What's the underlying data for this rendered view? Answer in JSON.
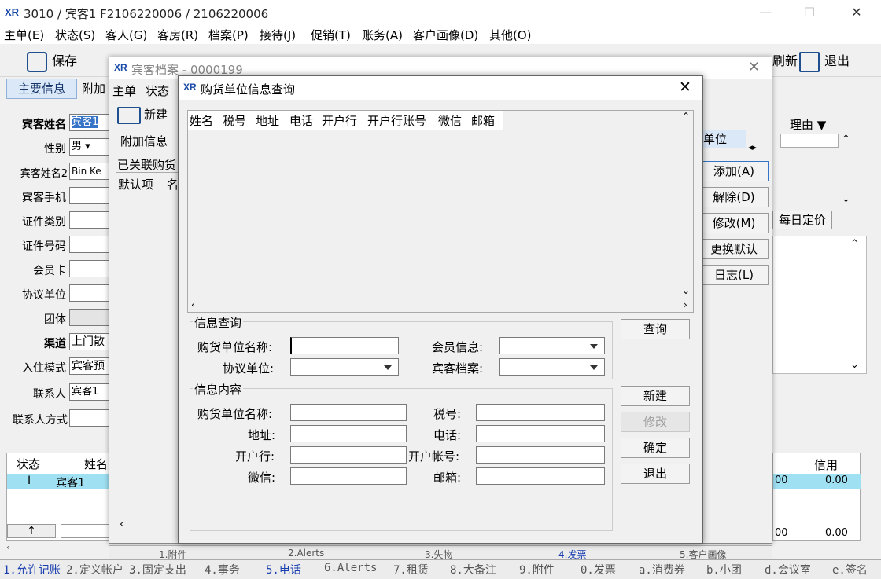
{
  "window": {
    "logo": "XR",
    "title": "3010 / 宾客1 F2106220006 / 2106220006"
  },
  "menu": [
    "主单(E)",
    "状态(S)",
    "客人(G)",
    "客房(R)",
    "档案(P)",
    "接待(J)",
    "促销(T)",
    "账务(A)",
    "客户画像(D)",
    "其他(O)"
  ],
  "toolbar": {
    "save": "保存",
    "refresh": "刷新",
    "exit": "退出"
  },
  "main": {
    "tab_main": "主要信息",
    "tab_extra": "附加",
    "fields": [
      {
        "label": "宾客姓名",
        "value": "宾客1"
      },
      {
        "label": "性别",
        "value": "男"
      },
      {
        "label": "宾客姓名2",
        "value": "Bin Ke"
      },
      {
        "label": "宾客手机",
        "value": ""
      },
      {
        "label": "证件类别",
        "value": ""
      },
      {
        "label": "证件号码",
        "value": ""
      },
      {
        "label": "会员卡",
        "value": ""
      },
      {
        "label": "协议单位",
        "value": ""
      },
      {
        "label": "团体",
        "value": ""
      },
      {
        "label": "渠道",
        "value": "上门散"
      },
      {
        "label": "入住模式",
        "value": "宾客预"
      },
      {
        "label": "联系人",
        "value": "宾客1"
      },
      {
        "label": "联系人方式",
        "value": ""
      }
    ],
    "grid_headers": [
      "状态",
      "姓名"
    ],
    "grid_row": {
      "status": "I",
      "name": "宾客1"
    },
    "right_headers": {
      "reason": "理由",
      "credit": "信用"
    },
    "right_values": {
      "v1": "00",
      "v2": "0.00",
      "v3": "00",
      "v4": "0.00"
    },
    "daily_price": "每日定价"
  },
  "bottom_tabs": [
    "1.允许记账",
    "2.定义帐户",
    "3.固定支出",
    "4.事务",
    "5.电话",
    "6.Alerts",
    "7.租赁",
    "8.大备注",
    "9.附件",
    "0.发票",
    "a.消费券",
    "b.小团",
    "d.会议室",
    "e.签名"
  ],
  "guest_dialog": {
    "title": "宾客档案 - 0000199",
    "menu": [
      "主单",
      "状态"
    ],
    "new_btn": "新建",
    "extra_info": "附加信息",
    "linked": "已关联购货",
    "cols": [
      "默认项",
      "名"
    ],
    "unit_tab": "单位",
    "side_buttons": [
      "添加(A)",
      "解除(D)",
      "修改(M)",
      "更换默认",
      "日志(L)"
    ],
    "tabs": [
      "1.附件",
      "2.Alerts",
      "3.失物",
      "4.发票",
      "5.客户画像"
    ]
  },
  "query_dialog": {
    "title": "购货单位信息查询",
    "columns": [
      "姓名",
      "税号",
      "地址",
      "电话",
      "开户行",
      "开户行账号",
      "微信",
      "邮箱"
    ],
    "search_group": "信息查询",
    "search_fields": {
      "unit_name": "购货单位名称:",
      "member": "会员信息:",
      "agreement": "协议单位:",
      "guest_file": "宾客档案:"
    },
    "content_group": "信息内容",
    "content_fields": {
      "unit_name": "购货单位名称:",
      "tax": "税号:",
      "address": "地址:",
      "phone": "电话:",
      "bank": "开户行:",
      "account": "开户帐号:",
      "wechat": "微信:",
      "email": "邮箱:"
    },
    "buttons": {
      "query": "查询",
      "new": "新建",
      "modify": "修改",
      "ok": "确定",
      "exit": "退出"
    }
  }
}
